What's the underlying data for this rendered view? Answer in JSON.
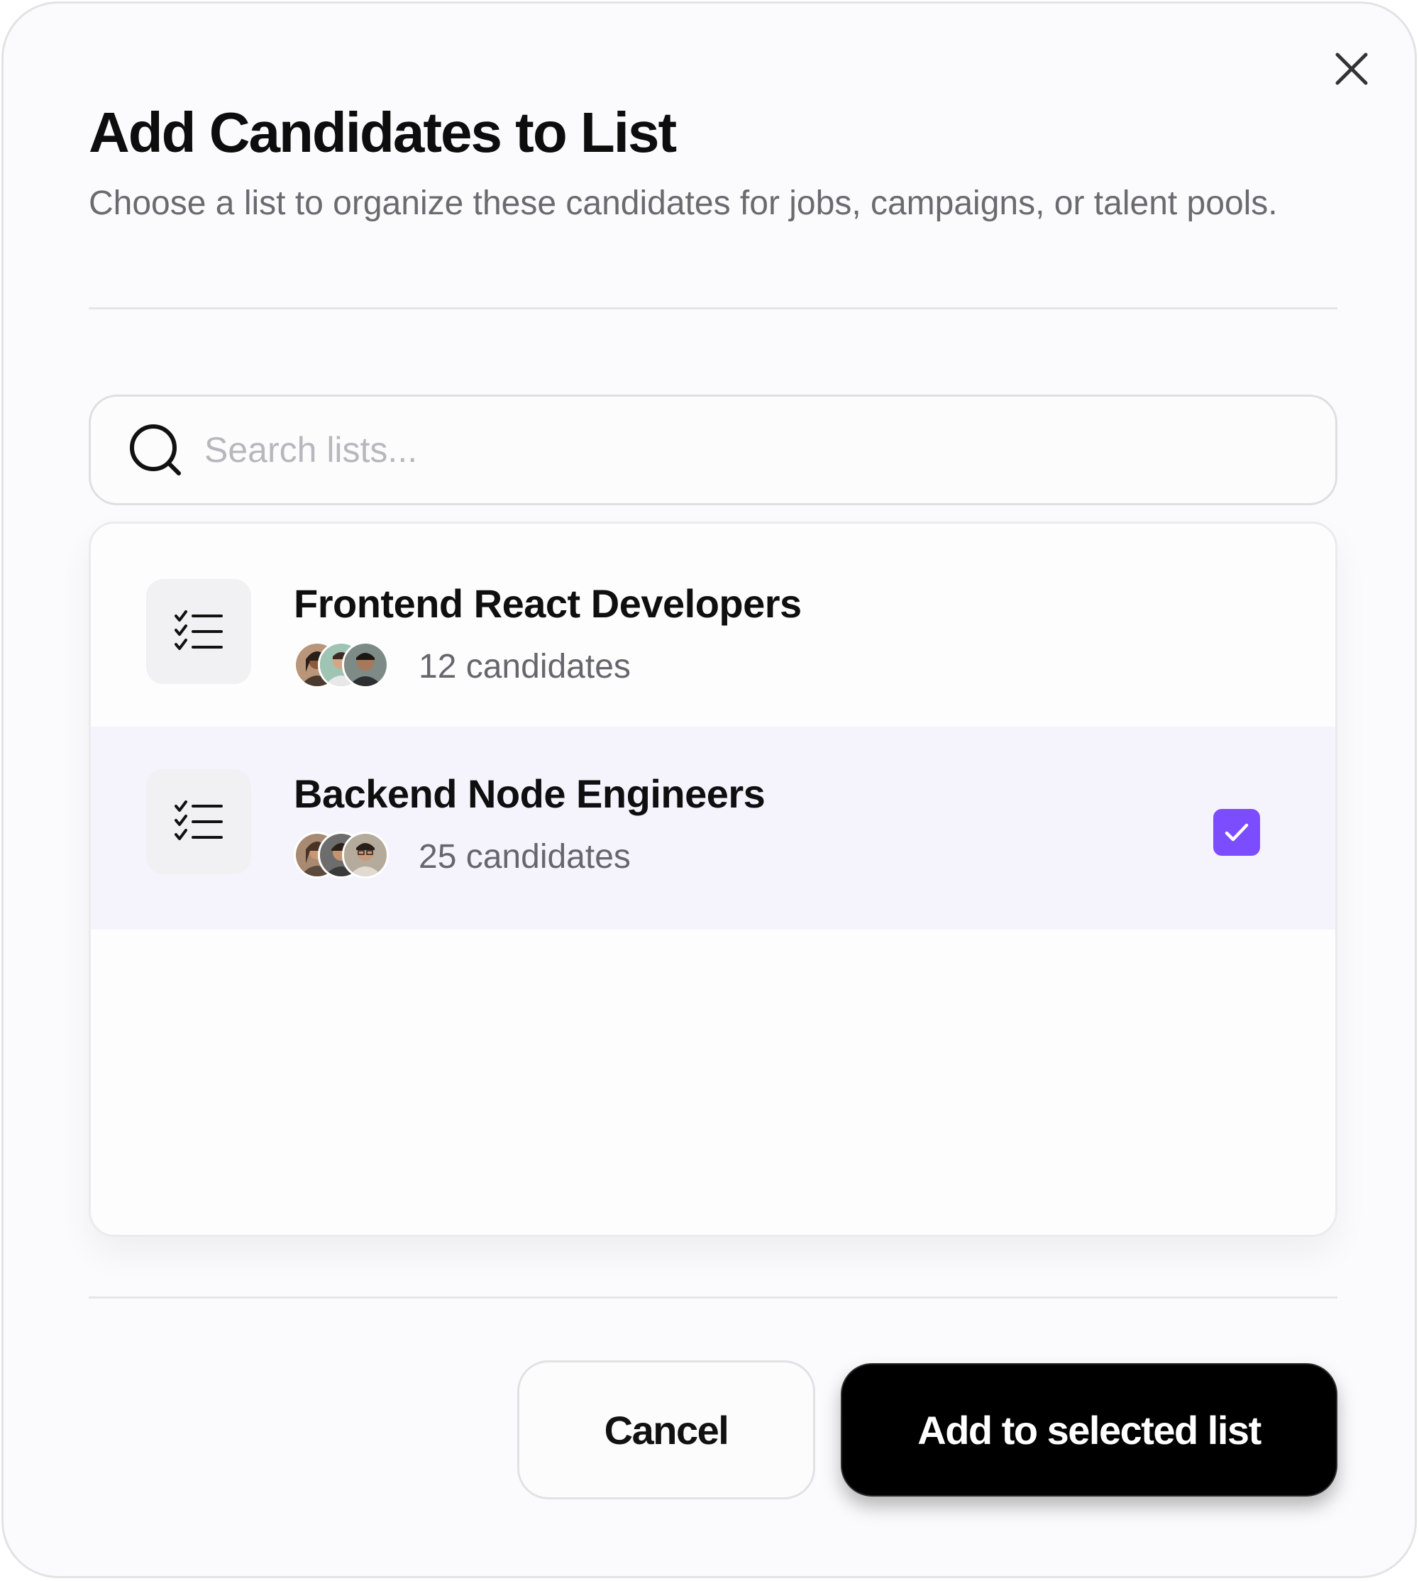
{
  "dialog": {
    "title": "Add Candidates to List",
    "subtitle": "Choose a list to organize these candidates for jobs, campaigns, or talent pools.",
    "close_icon": "close-icon"
  },
  "search": {
    "placeholder": "Search lists...",
    "value": "",
    "icon": "search-icon"
  },
  "lists": [
    {
      "name": "Frontend React Developers",
      "count": "12 candidates",
      "selected": false,
      "icon": "checklist-icon"
    },
    {
      "name": "Backend Node Engineers",
      "count": "25 candidates",
      "selected": true,
      "icon": "checklist-icon"
    }
  ],
  "actions": {
    "cancel_label": "Cancel",
    "confirm_label": "Add to selected list"
  },
  "colors": {
    "accent": "#7c4dff",
    "selected_row": "#f5f4fd",
    "primary_button": "#000000"
  }
}
